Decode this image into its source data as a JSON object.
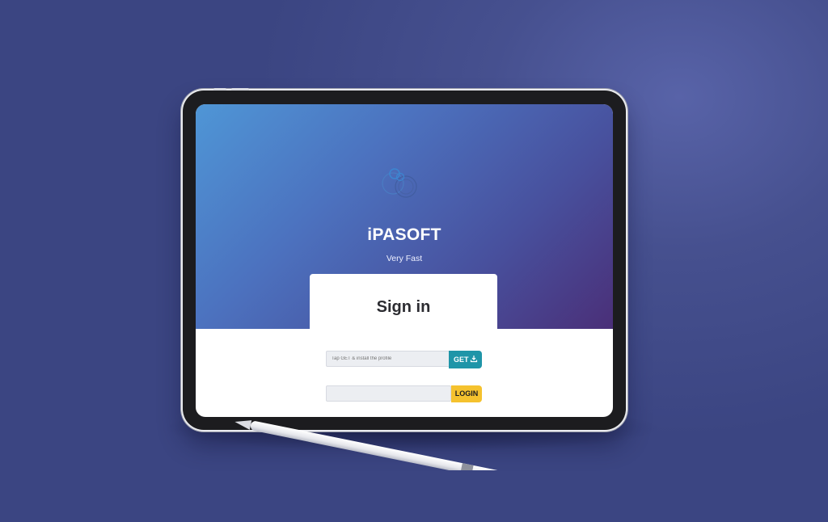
{
  "app": {
    "brand": "iPASOFT",
    "tagline": "Very Fast"
  },
  "signin": {
    "title": "Sign in",
    "profile_placeholder": "Tap GET & install the profile",
    "get_label": "GET",
    "login_value": "",
    "login_label": "LOGIN"
  },
  "icons": {
    "logo": "circles-logo-icon",
    "download": "download-icon"
  },
  "colors": {
    "background": "#46508f",
    "hero_start": "#4f96d6",
    "hero_end": "#4a2f78",
    "get_button": "#1f95a8",
    "login_button": "#f5c22e"
  }
}
